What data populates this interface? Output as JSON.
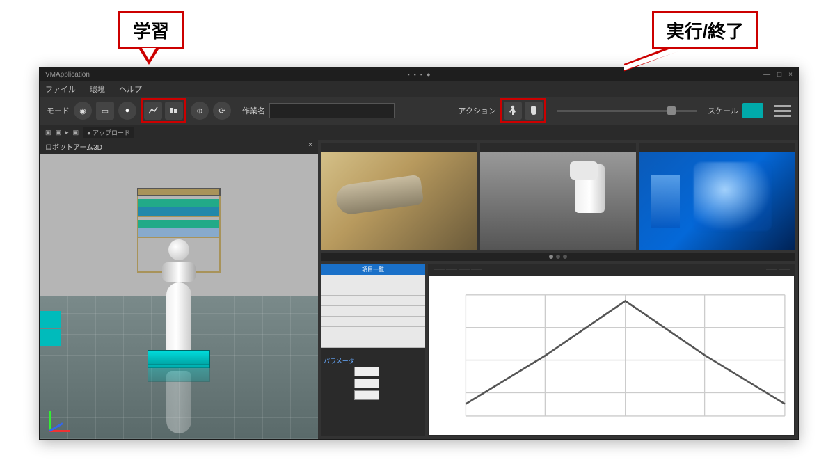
{
  "callouts": {
    "learn": "学習",
    "run_stop": "実行/終了"
  },
  "titlebar": {
    "app_name": "VMApplication",
    "center_items": [
      "",
      "",
      ""
    ],
    "win_controls": [
      "—",
      "□",
      "×"
    ]
  },
  "menubar": {
    "items": [
      "ファイル",
      "環境",
      "ヘルプ"
    ]
  },
  "toolbar": {
    "mode_label": "モード",
    "task_label": "作業名",
    "task_value": "",
    "action_label": "アクション",
    "right_label": "スケール"
  },
  "secondary_bar": {
    "items": [
      "",
      "",
      ""
    ],
    "upload_label": "アップロード"
  },
  "left_panel": {
    "title": "ロボットアーム3D"
  },
  "cameras": {
    "cam1_label": "",
    "cam2_label": "",
    "cam3_label": ""
  },
  "table": {
    "header": "項目一覧",
    "rows": [
      "",
      "",
      "",
      "",
      "",
      "",
      ""
    ]
  },
  "params": {
    "section": "パラメータ",
    "rows": [
      {
        "label": "",
        "value": ""
      },
      {
        "label": "",
        "value": ""
      },
      {
        "label": "",
        "value": ""
      }
    ]
  },
  "chart": {
    "tabs": [
      "",
      "",
      "",
      ""
    ],
    "right_tabs": [
      "",
      ""
    ]
  },
  "chart_data": {
    "type": "line",
    "x": [
      0,
      1,
      2,
      3,
      4
    ],
    "values": [
      10,
      50,
      95,
      50,
      10
    ],
    "xlabel": "",
    "ylabel": "",
    "ylim": [
      0,
      100
    ]
  }
}
